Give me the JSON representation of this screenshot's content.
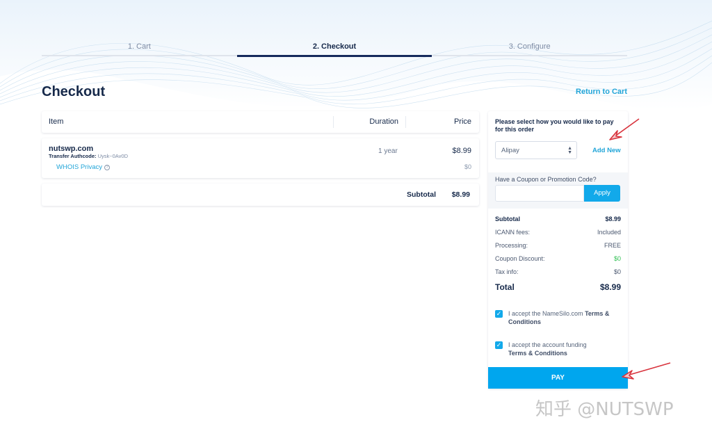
{
  "steps": [
    "1. Cart",
    "2. Checkout",
    "3. Configure"
  ],
  "active_step": 1,
  "page_title": "Checkout",
  "return_link": "Return to Cart",
  "table": {
    "headers": {
      "item": "Item",
      "duration": "Duration",
      "price": "Price"
    },
    "row": {
      "domain": "nutswp.com",
      "authcode_label": "Transfer Authcode:",
      "authcode_value": "Uysk~0Av0D",
      "duration": "1 year",
      "price": "$8.99",
      "addon": "WHOIS Privacy",
      "addon_price": "$0"
    },
    "subtotal_label": "Subtotal",
    "subtotal_value": "$8.99"
  },
  "payment": {
    "prompt": "Please select how you would like to pay for this order",
    "selected_method": "Alipay",
    "add_new": "Add New",
    "coupon_label": "Have a Coupon or Promotion Code?",
    "coupon_value": "",
    "apply_label": "Apply"
  },
  "summary": {
    "subtotal_label": "Subtotal",
    "subtotal_value": "$8.99",
    "icann_label": "ICANN fees:",
    "icann_value": "Included",
    "processing_label": "Processing:",
    "processing_value": "FREE",
    "coupon_label": "Coupon Discount:",
    "coupon_value": "$0",
    "tax_label": "Tax info:",
    "tax_value": "$0",
    "total_label": "Total",
    "total_value": "$8.99"
  },
  "terms1": {
    "checked": true,
    "prefix": "I accept the NameSilo.com ",
    "link": "Terms & Conditions"
  },
  "terms2": {
    "checked": true,
    "prefix": "I accept the account funding ",
    "link": "Terms & Conditions"
  },
  "pay_label": "PAY",
  "watermark": "知乎 @NUTSWP",
  "colors": {
    "accent": "#12a9ea",
    "navy": "#16294a",
    "link": "#21a5d8",
    "success": "#2fbf52",
    "arrow": "#d8323c"
  }
}
